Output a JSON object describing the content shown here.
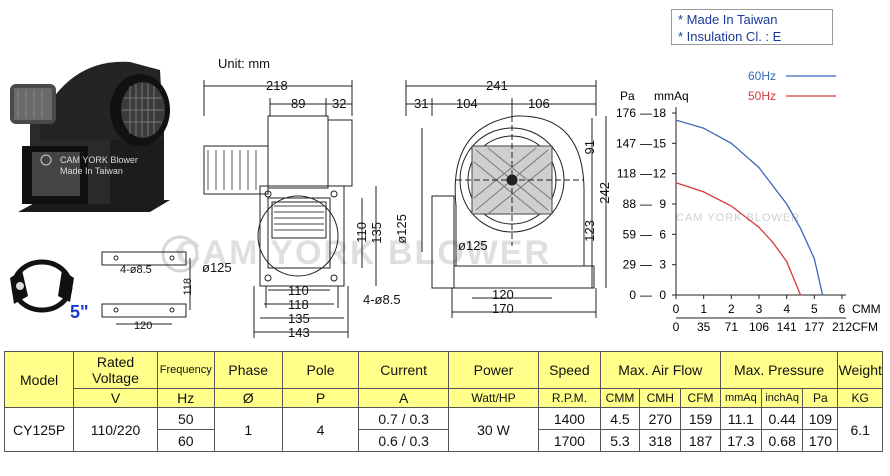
{
  "info_box": {
    "line1": "* Made In Taiwan",
    "line2": "* Insulation Cl. : E"
  },
  "photo": {
    "brand_text": "CAM YORK Blower",
    "made_text": "Made In Taiwan"
  },
  "watermark": {
    "text": "CAM YORK BLOWER",
    "chart_text": "CAM YORK BLOWER"
  },
  "size_label": "5\"",
  "drawing": {
    "unit": "Unit: mm",
    "side": {
      "overall": "218",
      "d1": "89",
      "d2": "32",
      "dia": "ø125",
      "w110": "110",
      "w118": "118",
      "w135": "135",
      "w143": "143",
      "h110": "110",
      "h135": "135",
      "hole": "4-ø8.5"
    },
    "front": {
      "overall": "241",
      "d31": "31",
      "d104": "104",
      "d106": "106",
      "h91": "91",
      "h242": "242",
      "h123": "123",
      "dia": "ø125",
      "dia_inlet": "ø125",
      "w120": "120",
      "w170": "170"
    },
    "bracket": {
      "hole": "4-ø8.5",
      "h118": "118",
      "w120": "120"
    }
  },
  "chart_data": {
    "type": "line",
    "legend": [
      "60Hz",
      "50Hz"
    ],
    "colors": {
      "60Hz": "#3a68b8",
      "50Hz": "#d43a3a"
    },
    "y_unit_left": "Pa",
    "y_unit_right": "mmAq",
    "y_ticks_pa": [
      "176",
      "147",
      "118",
      "88",
      "59",
      "29",
      "0"
    ],
    "y_ticks_mmaq": [
      "18",
      "15",
      "12",
      "9",
      "6",
      "3",
      "0"
    ],
    "x_unit_cmm": "CMM",
    "x_unit_cfm": "CFM",
    "x_ticks_cmm": [
      "0",
      "1",
      "2",
      "3",
      "4",
      "5",
      "6"
    ],
    "x_ticks_cfm": [
      "0",
      "35",
      "71",
      "106",
      "141",
      "177",
      "212"
    ],
    "ylim": [
      0,
      18
    ],
    "xlim": [
      0,
      6
    ],
    "series": [
      {
        "name": "60Hz",
        "x": [
          0,
          1,
          2,
          3,
          4,
          4.5,
          5,
          5.3
        ],
        "y": [
          17.3,
          16.5,
          15.0,
          12.6,
          9.0,
          6.6,
          3.6,
          0
        ]
      },
      {
        "name": "50Hz",
        "x": [
          0,
          1,
          2,
          3,
          3.5,
          4,
          4.5
        ],
        "y": [
          11.1,
          10.2,
          8.8,
          6.7,
          5.2,
          3.3,
          0
        ]
      }
    ]
  },
  "table": {
    "h_model": "Model",
    "h_rated": "Rated Voltage",
    "h_freq": "Frequency",
    "h_phase": "Phase",
    "h_pole": "Pole",
    "h_current": "Current",
    "h_power": "Power",
    "h_speed": "Speed",
    "h_airflow": "Max. Air Flow",
    "h_pressure": "Max. Pressure",
    "h_weight": "Weight",
    "u_v": "V",
    "u_hz": "Hz",
    "u_phase": "Ø",
    "u_pole": "P",
    "u_a": "A",
    "u_w": "Watt/HP",
    "u_rpm": "R.P.M.",
    "u_cmm": "CMM",
    "u_cmh": "CMH",
    "u_cfm": "CFM",
    "u_mmaq": "mmAq",
    "u_inchaq": "inchAq",
    "u_pa": "Pa",
    "u_kg": "KG",
    "model": "CY125P",
    "voltage": "110/220",
    "phase": "1",
    "pole": "4",
    "power": "30 W",
    "weight": "6.1",
    "rows": [
      {
        "hz": "50",
        "current": "0.7 / 0.3",
        "rpm": "1400",
        "cmm": "4.5",
        "cmh": "270",
        "cfm": "159",
        "mmaq": "11.1",
        "inchaq": "0.44",
        "pa": "109"
      },
      {
        "hz": "60",
        "current": "0.6 / 0.3",
        "rpm": "1700",
        "cmm": "5.3",
        "cmh": "318",
        "cfm": "187",
        "mmaq": "17.3",
        "inchaq": "0.68",
        "pa": "170"
      }
    ]
  }
}
